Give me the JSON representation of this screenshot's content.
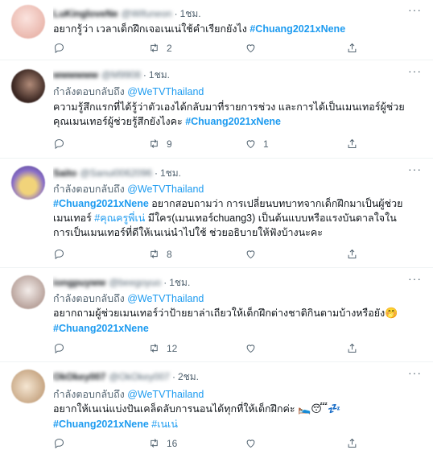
{
  "tweets": [
    {
      "name": "LuKingloveNe",
      "handle": "@Wifuneon",
      "time": "1ชม.",
      "reply_label": "",
      "reply_mention": "",
      "line1_text": "อยากรู้ว่า เวลาเด็กฝึกเจอเนเน่ใช้คำเรียกยังไง ",
      "line1_tag": "#Chuang2021xNene",
      "line2_text": "",
      "line2_tag": "",
      "line3_text": "",
      "line3_tag": "",
      "replies": "",
      "retweets": "2",
      "likes": "",
      "avatar_color": "#f2c9c2"
    },
    {
      "name": "wwwwww",
      "handle": "@M9908",
      "time": "1ชม.",
      "reply_label": "กำลังตอบกลับถึง ",
      "reply_mention": "@WeTVThailand",
      "line1_text": "ความรู้สึกแรกที่ได้รู้ว่าตัวเองได้กลับมาที่รายการช่วง และการได้เป็นเมนเทอร์ผู้ช่วย",
      "line1_tag": "",
      "line2_text": "คุณเมนเทอร์ผู้ช่วยรู้สึกยังไงคะ ",
      "line2_tag": "#Chuang2021xNene",
      "line3_text": "",
      "line3_tag": "",
      "replies": "",
      "retweets": "9",
      "likes": "1",
      "avatar_color": "#5a3a2e"
    },
    {
      "name": "Saito",
      "handle": "@Sanui0062096",
      "time": "1ชม.",
      "reply_label": "กำลังตอบกลับถึง ",
      "reply_mention": "@WeTVThailand",
      "line1_tag": "#Chuang2021xNene",
      "line1_text": " อยากสอบถามว่า การเปลี่ยนบทบาทจากเด็กฝึกมาเป็นผู้ช่วย",
      "line2_text": "เมนเทอร์ ",
      "line2_link": "#คุณครูพี่เน่",
      "line2_rest": " มีใคร(เมนเทอร์chuang3) เป็นต้นแบบหรือแรงบันดาลใจใน",
      "line3_text": "การเป็นเมนเทอร์ที่ดีให้เนเน่นำไปใช้ ช่วยอธิบายให้ฟังบ้างนะคะ",
      "replies": "",
      "retweets": "8",
      "likes": "",
      "avatar_color": "#7b62b8"
    },
    {
      "name": "iongpuyww",
      "handle": "@beegoyuo",
      "time": "1ชม.",
      "reply_label": "กำลังตอบกลับถึง ",
      "reply_mention": "@WeTVThailand",
      "line1_text": "อยากถามผู้ช่วยเมนเทอร์ว่าป้ายยาล่าเถียวให้เด็กฝึกต่างชาติกินตามบ้างหรือยัง",
      "line1_emoji": "🤭",
      "line2_tag": "#Chuang2021xNene",
      "replies": "",
      "retweets": "12",
      "likes": "",
      "avatar_color": "#c9b8b2"
    },
    {
      "name": "OkOkey007",
      "handle": "@OkOkey007",
      "time": "2ชม.",
      "reply_label": "กำลังตอบกลับถึง ",
      "reply_mention": "@WeTVThailand",
      "line1_text": "อยากให้เนเน่แบ่งปันเคล็ดลับการนอนได้ทุกที่ให้เด็กฝึกค่ะ ",
      "line1_emoji": "🛌😴💤",
      "line2_tag": "#Chuang2021xNene",
      "line2_link": " #เนเน่",
      "replies": "",
      "retweets": "16",
      "likes": "",
      "avatar_color": "#d8c2a8"
    }
  ]
}
